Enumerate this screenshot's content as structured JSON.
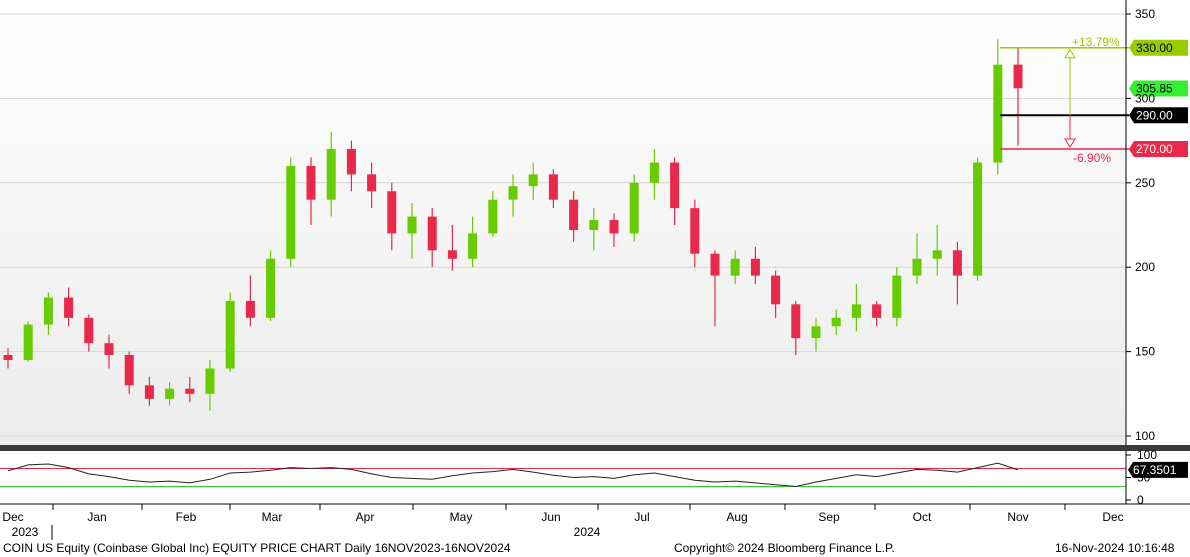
{
  "chart_data": {
    "type": "candlestick",
    "main_panel": {
      "ylim": [
        95,
        355
      ],
      "yticks": [
        100,
        150,
        200,
        250,
        300,
        350
      ],
      "grid": true,
      "up_color": "#66cc00",
      "down_color": "#e8294a",
      "ohlc_weekly": [
        [
          "2023-12-01",
          148,
          152,
          140,
          145
        ],
        [
          "2023-12-08",
          145,
          168,
          144,
          166
        ],
        [
          "2023-12-15",
          166,
          185,
          160,
          182
        ],
        [
          "2023-12-22",
          182,
          188,
          165,
          170
        ],
        [
          "2023-12-29",
          170,
          172,
          150,
          155
        ],
        [
          "2024-01-05",
          155,
          160,
          140,
          148
        ],
        [
          "2024-01-12",
          148,
          150,
          125,
          130
        ],
        [
          "2024-01-19",
          130,
          135,
          118,
          122
        ],
        [
          "2024-01-26",
          122,
          132,
          118,
          128
        ],
        [
          "2024-02-02",
          128,
          135,
          120,
          125
        ],
        [
          "2024-02-09",
          125,
          145,
          115,
          140
        ],
        [
          "2024-02-16",
          140,
          185,
          138,
          180
        ],
        [
          "2024-02-23",
          180,
          195,
          165,
          170
        ],
        [
          "2024-03-01",
          170,
          210,
          168,
          205
        ],
        [
          "2024-03-08",
          205,
          265,
          200,
          260
        ],
        [
          "2024-03-15",
          260,
          265,
          225,
          240
        ],
        [
          "2024-03-22",
          240,
          280,
          230,
          270
        ],
        [
          "2024-03-29",
          270,
          275,
          245,
          255
        ],
        [
          "2024-04-05",
          255,
          262,
          235,
          245
        ],
        [
          "2024-04-12",
          245,
          250,
          210,
          220
        ],
        [
          "2024-04-19",
          220,
          238,
          205,
          230
        ],
        [
          "2024-04-26",
          230,
          235,
          200,
          210
        ],
        [
          "2024-05-03",
          210,
          225,
          198,
          205
        ],
        [
          "2024-05-10",
          205,
          230,
          200,
          220
        ],
        [
          "2024-05-17",
          220,
          245,
          218,
          240
        ],
        [
          "2024-05-24",
          240,
          255,
          230,
          248
        ],
        [
          "2024-05-31",
          248,
          262,
          240,
          255
        ],
        [
          "2024-06-07",
          255,
          258,
          235,
          240
        ],
        [
          "2024-06-14",
          240,
          245,
          215,
          222
        ],
        [
          "2024-06-21",
          222,
          235,
          210,
          228
        ],
        [
          "2024-06-28",
          228,
          232,
          212,
          220
        ],
        [
          "2024-07-05",
          220,
          255,
          215,
          250
        ],
        [
          "2024-07-12",
          250,
          270,
          240,
          262
        ],
        [
          "2024-07-19",
          262,
          265,
          225,
          235
        ],
        [
          "2024-07-26",
          235,
          240,
          200,
          208
        ],
        [
          "2024-08-02",
          208,
          210,
          165,
          195
        ],
        [
          "2024-08-09",
          195,
          210,
          190,
          205
        ],
        [
          "2024-08-16",
          205,
          212,
          190,
          195
        ],
        [
          "2024-08-23",
          195,
          198,
          170,
          178
        ],
        [
          "2024-08-30",
          178,
          180,
          148,
          158
        ],
        [
          "2024-09-06",
          158,
          170,
          150,
          165
        ],
        [
          "2024-09-13",
          165,
          175,
          160,
          170
        ],
        [
          "2024-09-20",
          170,
          190,
          162,
          178
        ],
        [
          "2024-09-27",
          178,
          180,
          165,
          170
        ],
        [
          "2024-10-04",
          170,
          200,
          165,
          195
        ],
        [
          "2024-10-11",
          195,
          220,
          190,
          205
        ],
        [
          "2024-10-18",
          205,
          225,
          195,
          210
        ],
        [
          "2024-10-25",
          210,
          215,
          178,
          195
        ],
        [
          "2024-11-01",
          195,
          265,
          192,
          262
        ],
        [
          "2024-11-08",
          262,
          335,
          255,
          320
        ],
        [
          "2024-11-15",
          320,
          330,
          272,
          306
        ]
      ],
      "horizontal_levels": [
        {
          "value": 330.0,
          "label": "330.00",
          "color": "#99cc00"
        },
        {
          "value": 305.85,
          "label": "305.85",
          "color": "#33ee33"
        },
        {
          "value": 290.0,
          "label": "290.00",
          "color": "#000000"
        },
        {
          "value": 270.0,
          "label": "270.00",
          "color": "#e8294a"
        }
      ],
      "annotations": [
        {
          "text": "+13.79%",
          "color": "#99cc00"
        },
        {
          "text": "-6.90%",
          "color": "#e8294a"
        }
      ]
    },
    "rsi_panel": {
      "ylim": [
        0,
        100
      ],
      "yticks": [
        0,
        50,
        100
      ],
      "upper_level": 70,
      "lower_level": 30,
      "current_value_label": "67.3501",
      "values": [
        65,
        78,
        80,
        72,
        58,
        52,
        44,
        40,
        42,
        38,
        46,
        60,
        62,
        66,
        72,
        70,
        72,
        68,
        58,
        50,
        48,
        46,
        54,
        60,
        63,
        68,
        62,
        55,
        50,
        52,
        48,
        56,
        60,
        52,
        44,
        40,
        42,
        38,
        34,
        30,
        40,
        48,
        56,
        52,
        60,
        68,
        66,
        62,
        72,
        82,
        67
      ]
    },
    "x_axis": {
      "months": [
        "Dec",
        "Jan",
        "Feb",
        "Mar",
        "Apr",
        "May",
        "Jun",
        "Jul",
        "Aug",
        "Sep",
        "Oct",
        "Nov",
        "Dec"
      ],
      "years": [
        "2023",
        "2024"
      ]
    }
  },
  "footer": {
    "left": "COIN US Equity (Coinbase Global Inc) EQUITY PRICE CHART  Daily 16NOV2023-16NOV2024",
    "center": "Copyright© 2024 Bloomberg Finance L.P.",
    "right": "16-Nov-2024 10:16:48"
  }
}
